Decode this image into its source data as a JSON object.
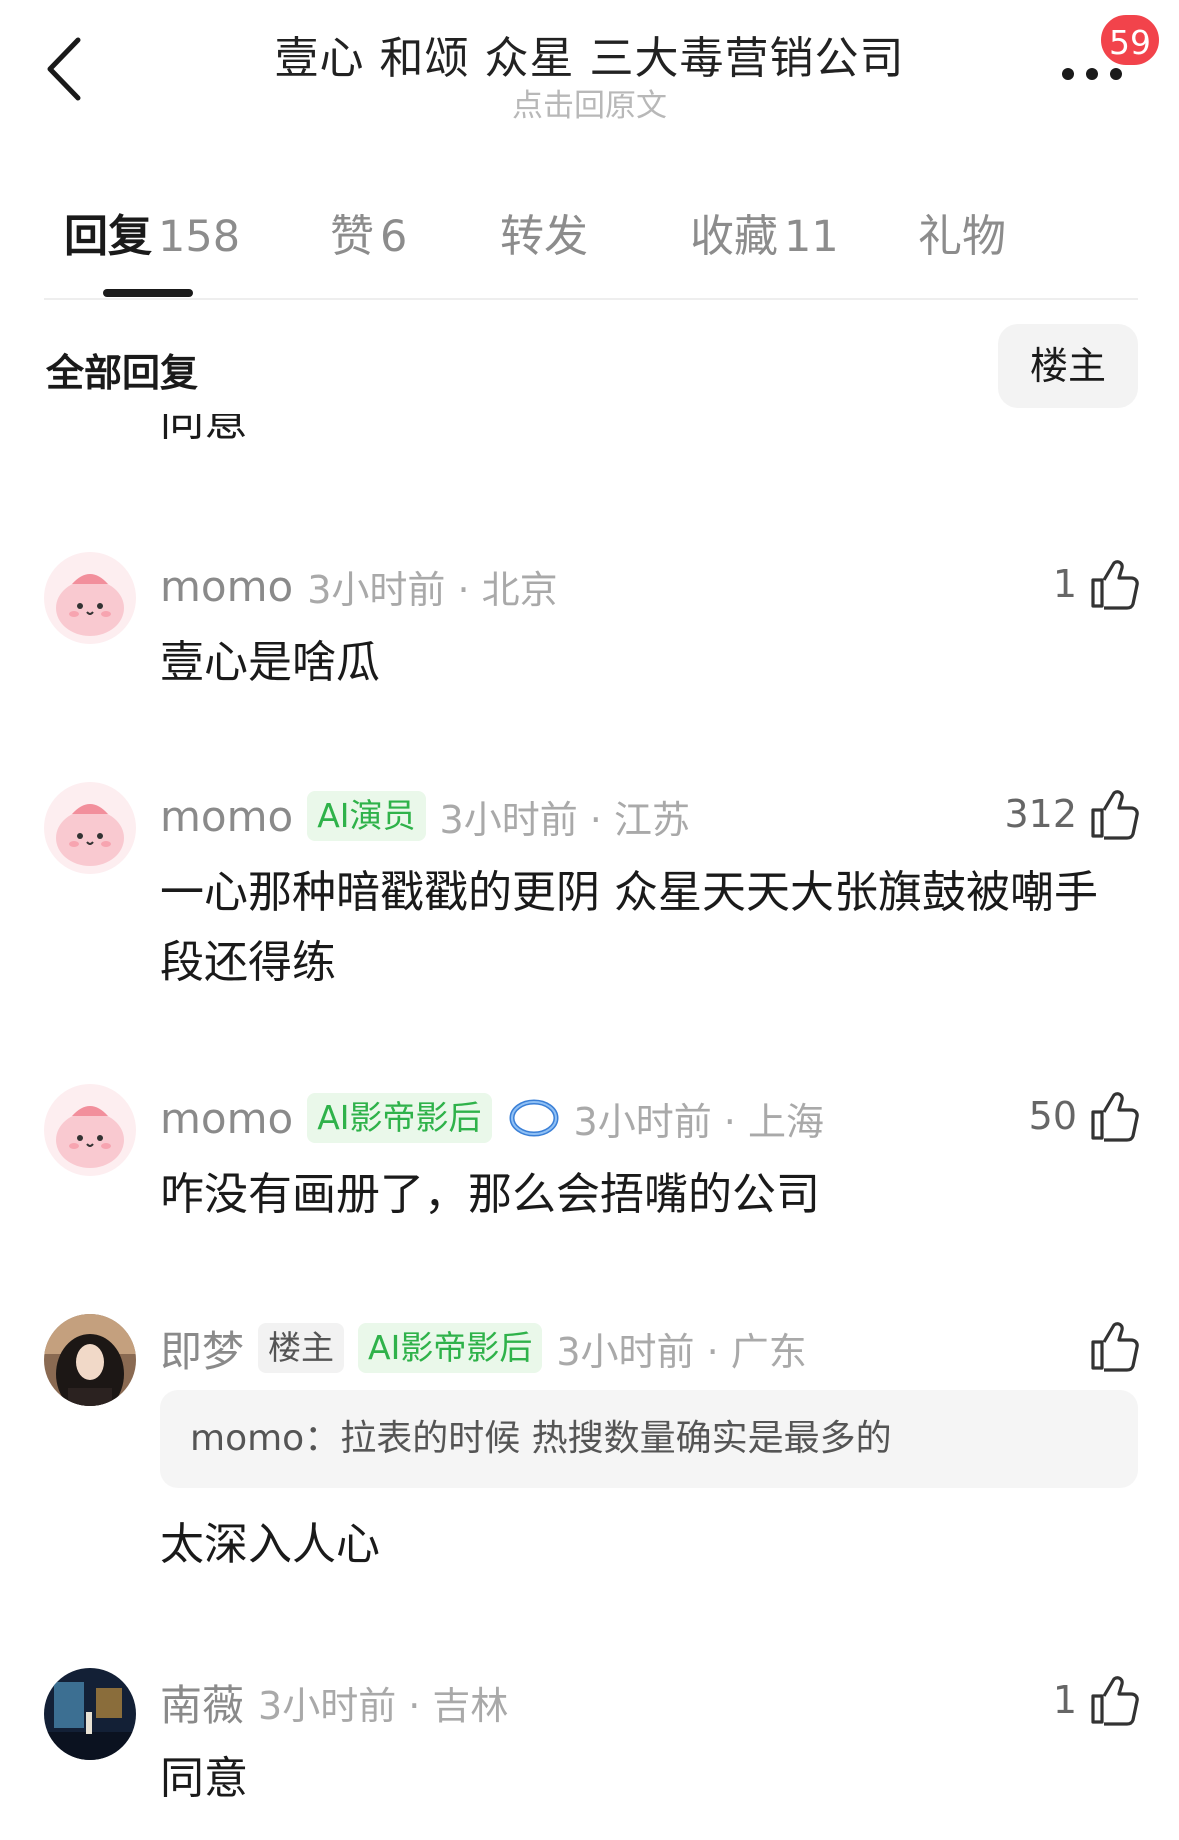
{
  "header": {
    "title": "壹心 和颂 众星 三大毒营销公司",
    "subtitle": "点击回原文",
    "back_icon": "chevron-left-icon",
    "more_icon": "more-dots-icon",
    "notification_count": "59"
  },
  "tabs": [
    {
      "label": "回复",
      "count": "158",
      "active": true
    },
    {
      "label": "赞",
      "count": "6",
      "active": false
    },
    {
      "label": "转发",
      "count": "",
      "active": false
    },
    {
      "label": "收藏",
      "count": "11",
      "active": false
    },
    {
      "label": "礼物",
      "count": "",
      "active": false
    }
  ],
  "filter": {
    "title": "全部回复",
    "owner_button": "楼主"
  },
  "cut_off_text": "同意",
  "comments": [
    {
      "user": "momo",
      "time": "3小时前 · 北京",
      "likes": "1",
      "text": "壹心是啥瓜"
    },
    {
      "user": "momo",
      "tag": "AI演员",
      "time": "3小时前 · 江苏",
      "likes": "312",
      "text": "一心那种暗戳戳的更阴 众星天天大张旗鼓被嘲手段还得练"
    },
    {
      "user": "momo",
      "tag": "AI影帝影后",
      "time": "3小时前 · 上海",
      "likes": "50",
      "text": "咋没有画册了，那么会捂嘴的公司"
    },
    {
      "user": "即梦",
      "owner_tag": "楼主",
      "tag": "AI影帝影后",
      "time": "3小时前 · 广东",
      "likes": "",
      "quote": "momo：拉表的时候 热搜数量确实是最多的",
      "text": "太深入人心"
    },
    {
      "user": "南薇",
      "time": "3小时前 · 吉林",
      "likes": "1",
      "text": "同意"
    }
  ],
  "colors": {
    "badge": "#f2434b",
    "ai_tag_bg": "#eaf8ea",
    "ai_tag_text": "#2fb24a",
    "ring_icon": "#3a7fd6"
  }
}
